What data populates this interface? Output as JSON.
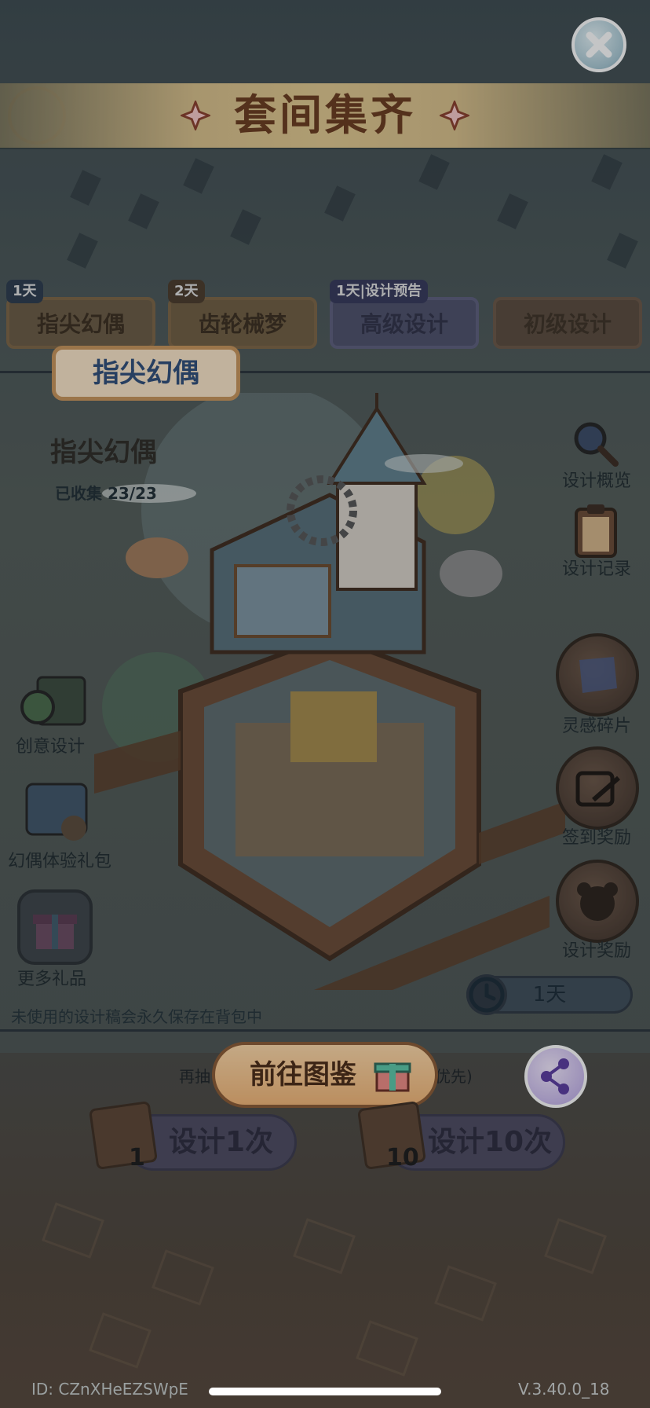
{
  "header": {
    "title": "套间集齐"
  },
  "tabs": [
    {
      "label": "指尖幻偶",
      "badge": "1天"
    },
    {
      "label": "齿轮械梦",
      "badge": "2天"
    },
    {
      "label": "高级设计",
      "badge": "1天|设计预告"
    },
    {
      "label": "初级设计"
    }
  ],
  "selected_set": {
    "plaque": "指尖幻偶",
    "name": "指尖幻偶",
    "collected": "已收集 23/23"
  },
  "right_menu": {
    "overview": "设计概览",
    "records": "设计记录",
    "inspiration": "灵感碎片",
    "checkin": "签到奖励",
    "design_reward": "设计奖励"
  },
  "left_menu": {
    "creative": "创意设计",
    "doll_pack": "幻偶体验礼包",
    "more_gifts": "更多礼品"
  },
  "tip": "未使用的设计稿会永久保存在背包中",
  "timer": "1天",
  "go_button": "前往图鉴",
  "partial_text_left": "再抽",
  "partial_text_right": "优先)",
  "draw_once": {
    "label": "设计1次",
    "count": "1"
  },
  "draw_ten": {
    "label": "设计10次",
    "count": "10"
  },
  "footer": {
    "id": "ID:  CZnXHeEZSWpE",
    "version": "V.3.40.0_18"
  },
  "colors": {
    "title": "#6a3a1c",
    "banner": "#e2c98f",
    "plaque_text": "#2e4c78",
    "go_button": "#f3b676"
  }
}
